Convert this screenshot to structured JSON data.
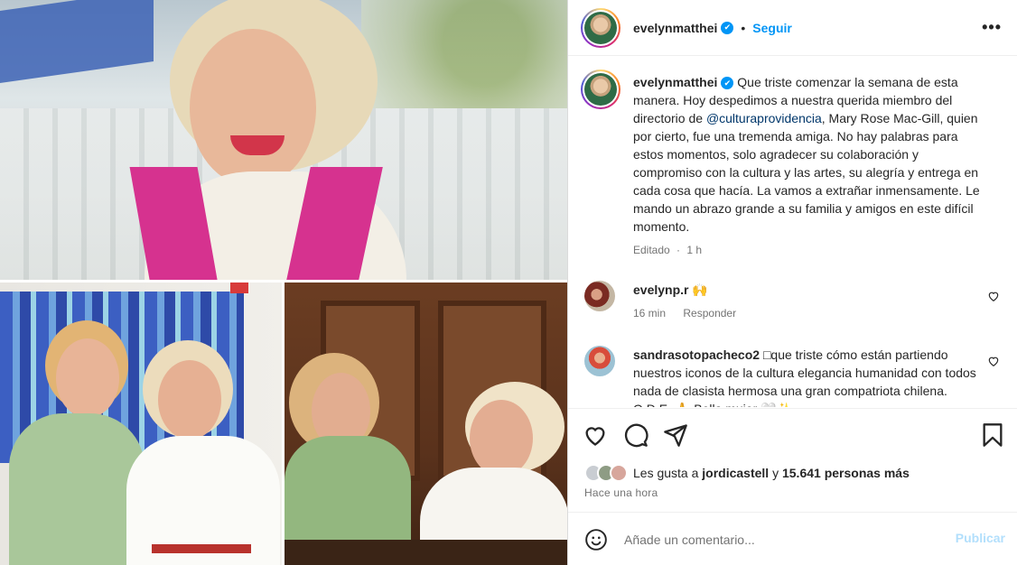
{
  "post": {
    "author": "evelynmatthei",
    "follow_label": "Seguir",
    "separator": "•",
    "more_label": "•••",
    "verified_mark": "✔",
    "caption": {
      "before_mention": "Que triste comenzar la semana de esta manera. Hoy despedimos a nuestra querida miembro del directorio de ",
      "mention": "@culturaprovidencia",
      "after_mention": ", Mary Rose Mac-Gill, quien por cierto, fue una tremenda amiga. No hay palabras para estos momentos, solo agradecer su colaboración y compromiso con la cultura y las artes, su alegría y entrega en cada cosa que hacía. La vamos a extrañar inmensamente. Le mando un abrazo grande a su familia y amigos en este difícil momento."
    },
    "caption_meta": {
      "edited": "Editado",
      "dot": "·",
      "age": "1 h"
    }
  },
  "comments": [
    {
      "user": "evelynp.r",
      "text": "🙌",
      "age": "16 min",
      "reply": "Responder"
    },
    {
      "user": "sandrasotopacheco2",
      "text": "□que triste cómo están partiendo nuestros iconos de la cultura elegancia humanidad con todos nada de clasista hermosa una gran compatriota chilena. Q.D.E. 🙏 Bella mujer 🤍✨"
    }
  ],
  "likes": {
    "prefix": "Les gusta a",
    "user": "jordicastell",
    "conj": "y",
    "count": "15.641 personas más"
  },
  "timestamp": "Hace una hora",
  "composer": {
    "placeholder": "Añade un comentario...",
    "publish_label": "Publicar"
  },
  "colors": {
    "accent": "#0095f6",
    "publish_disabled": "#b2dffc",
    "muted": "#737373",
    "scarf": "#d6328f",
    "wall_blue": "#3c5fc2"
  },
  "icons": [
    "heart-icon",
    "comment-icon",
    "share-icon",
    "bookmark-icon",
    "emoji-icon",
    "more-icon",
    "verified-icon"
  ]
}
